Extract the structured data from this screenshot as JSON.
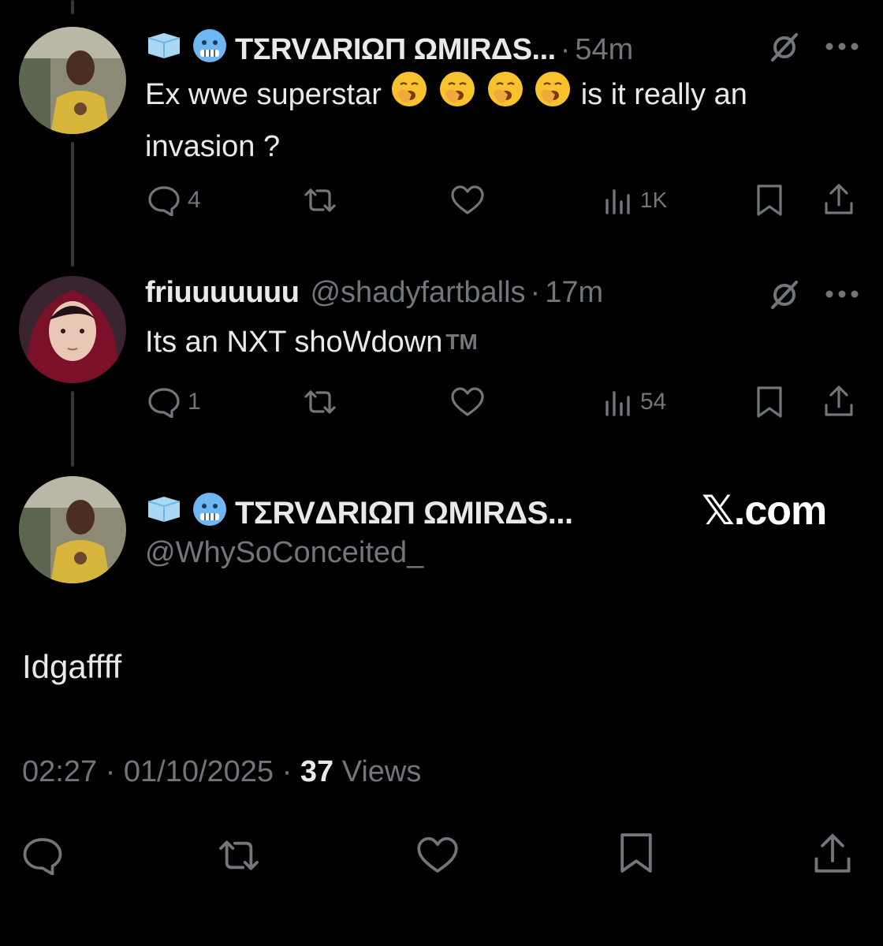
{
  "reply1": {
    "display_name": "ΤΣRVΔRIΩП ΩMIRΔS...",
    "time": "54m",
    "text_before": "Ex wwe superstar",
    "text_after": "is it really an",
    "text_line2": "invasion ?",
    "replies": "4",
    "views": "1K",
    "emoji_icon": "yawning-face-icon",
    "name_icons": [
      "ice-cube-icon",
      "cold-face-icon"
    ]
  },
  "reply2": {
    "display_name": "friuuuuuuu",
    "handle": "@shadyfartballs",
    "time": "17m",
    "text": "Its an NXT shoWdown",
    "tm": "TM",
    "replies": "1",
    "views": "54"
  },
  "main": {
    "display_name": "ΤΣRVΔRIΩП ΩMIRΔS...",
    "handle": "@WhySoConceited_",
    "text": "Idgaffff",
    "time": "02:27",
    "date": "01/10/2025",
    "views_count": "37",
    "views_label": "Views",
    "dot": "·"
  },
  "watermark": "𝕏.com",
  "colors": {
    "background": "#000000",
    "text": "#e7e9ea",
    "muted": "#71767b",
    "thread_line": "#333639"
  }
}
